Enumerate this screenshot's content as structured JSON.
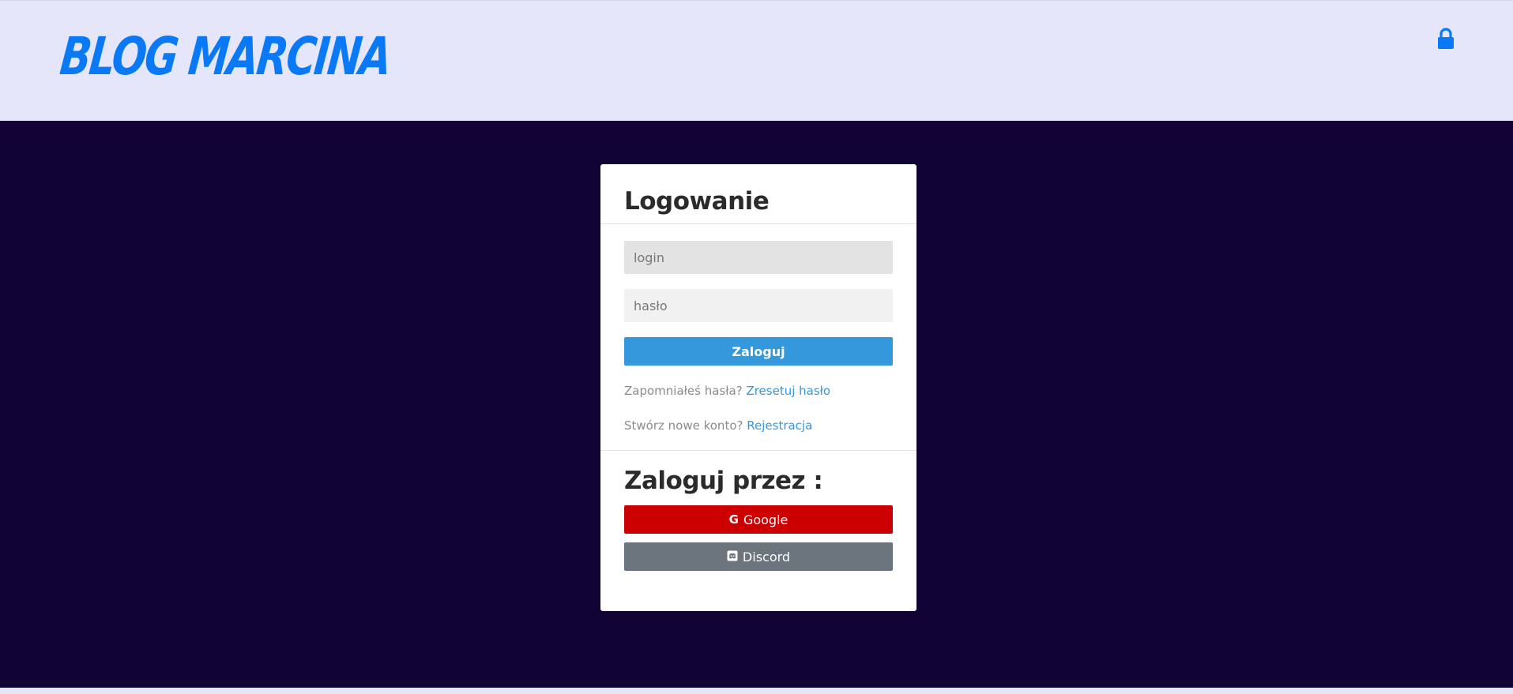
{
  "header": {
    "brand": "BLOG MARCINA",
    "lock_icon": "lock-icon"
  },
  "login_card": {
    "title": "Logowanie",
    "login_placeholder": "login",
    "password_placeholder": "hasło",
    "login_button": "Zaloguj",
    "forgot_prompt": "Zapomniałeś hasła?",
    "forgot_link": "Zresetuj hasło",
    "register_prompt": "Stwórz nowe konto?",
    "register_link": "Rejestracja",
    "oauth_title": "Zaloguj przez :",
    "google_button": "Google",
    "google_icon": "G",
    "discord_button": "Discord"
  },
  "colors": {
    "brand": "#0a79f6",
    "header_bg": "#e5e6f9",
    "main_bg": "#110333",
    "primary": "#3598dc",
    "google": "#cc0000",
    "discord": "#6c757d"
  }
}
